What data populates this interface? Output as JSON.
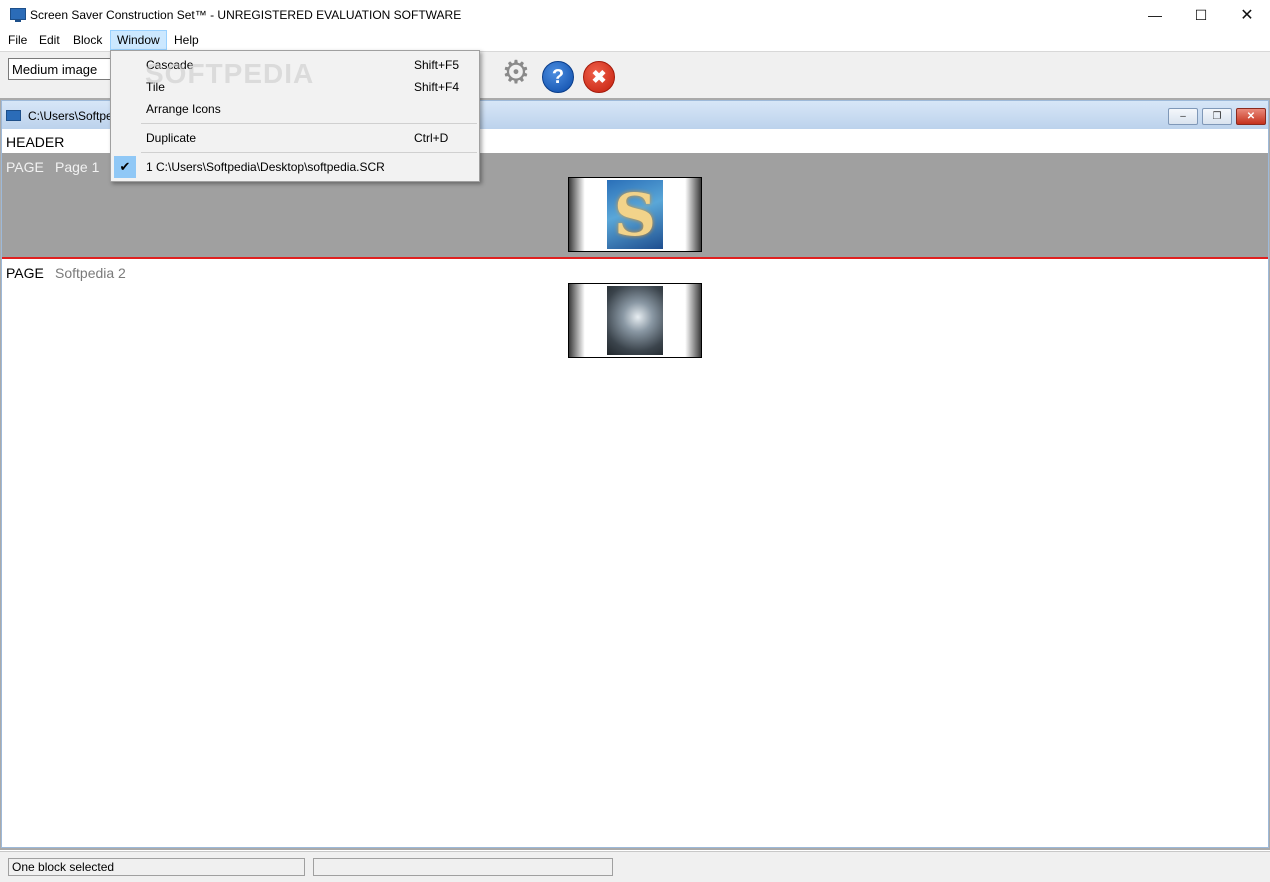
{
  "window": {
    "title": "Screen Saver Construction Set™ - UNREGISTERED EVALUATION SOFTWARE",
    "minimize_icon": "minimize-icon",
    "maximize_icon": "maximize-icon",
    "close_icon": "close-icon"
  },
  "menubar": {
    "items": [
      "File",
      "Edit",
      "Block",
      "Window",
      "Help"
    ],
    "active": "Window"
  },
  "toolbar": {
    "combo_value": "Medium image",
    "icons": [
      "gear-icon",
      "help-icon",
      "close-icon"
    ]
  },
  "window_menu": {
    "items": [
      {
        "label": "Cascade",
        "shortcut": "Shift+F5"
      },
      {
        "label": "Tile",
        "shortcut": "Shift+F4"
      },
      {
        "label": "Arrange Icons",
        "shortcut": ""
      },
      {
        "label": "Duplicate",
        "shortcut": "Ctrl+D"
      },
      {
        "label": "1 C:\\Users\\Softpedia\\Desktop\\softpedia.SCR",
        "shortcut": "",
        "checked": true
      }
    ]
  },
  "watermark": "SOFTPEDIA",
  "child_window": {
    "title": "C:\\Users\\Softpe",
    "header_label": "HEADER",
    "pages": [
      {
        "keyword": "PAGE",
        "name": "Page 1",
        "selected": true
      },
      {
        "keyword": "PAGE",
        "name": "Softpedia 2",
        "selected": false
      }
    ]
  },
  "statusbar": {
    "panel1": "One block selected",
    "panel2": ""
  },
  "colors": {
    "selection_border": "#e02020",
    "selected_page_bg": "#a0a0a0",
    "menu_highlight": "#cce8ff"
  }
}
